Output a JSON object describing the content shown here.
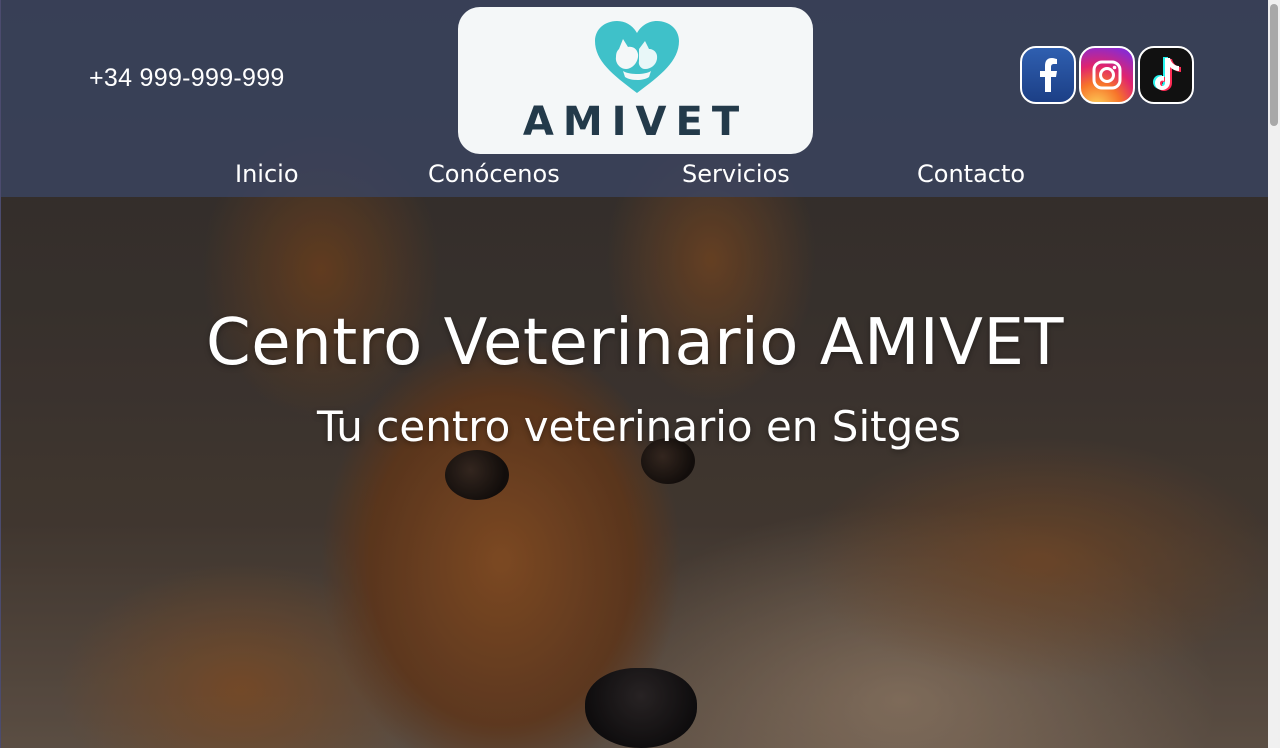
{
  "header": {
    "phone": "+34 999-999-999",
    "logo_text": "AMIVET",
    "logo_icon": "heart-cat-dog-icon",
    "social": [
      {
        "name": "facebook-icon",
        "label": "f"
      },
      {
        "name": "instagram-icon"
      },
      {
        "name": "tiktok-icon"
      }
    ],
    "nav": {
      "inicio": "Inicio",
      "conocenos": "Conócenos",
      "servicios": "Servicios",
      "contacto": "Contacto"
    }
  },
  "hero": {
    "title": "Centro Veterinario AMIVET",
    "subtitle": "Tu centro veterinario en Sitges"
  },
  "colors": {
    "header_bg": "#3a4460",
    "logo_teal": "#3fc1c9",
    "logo_text": "#233a4a",
    "facebook": "#2f5fb0"
  }
}
